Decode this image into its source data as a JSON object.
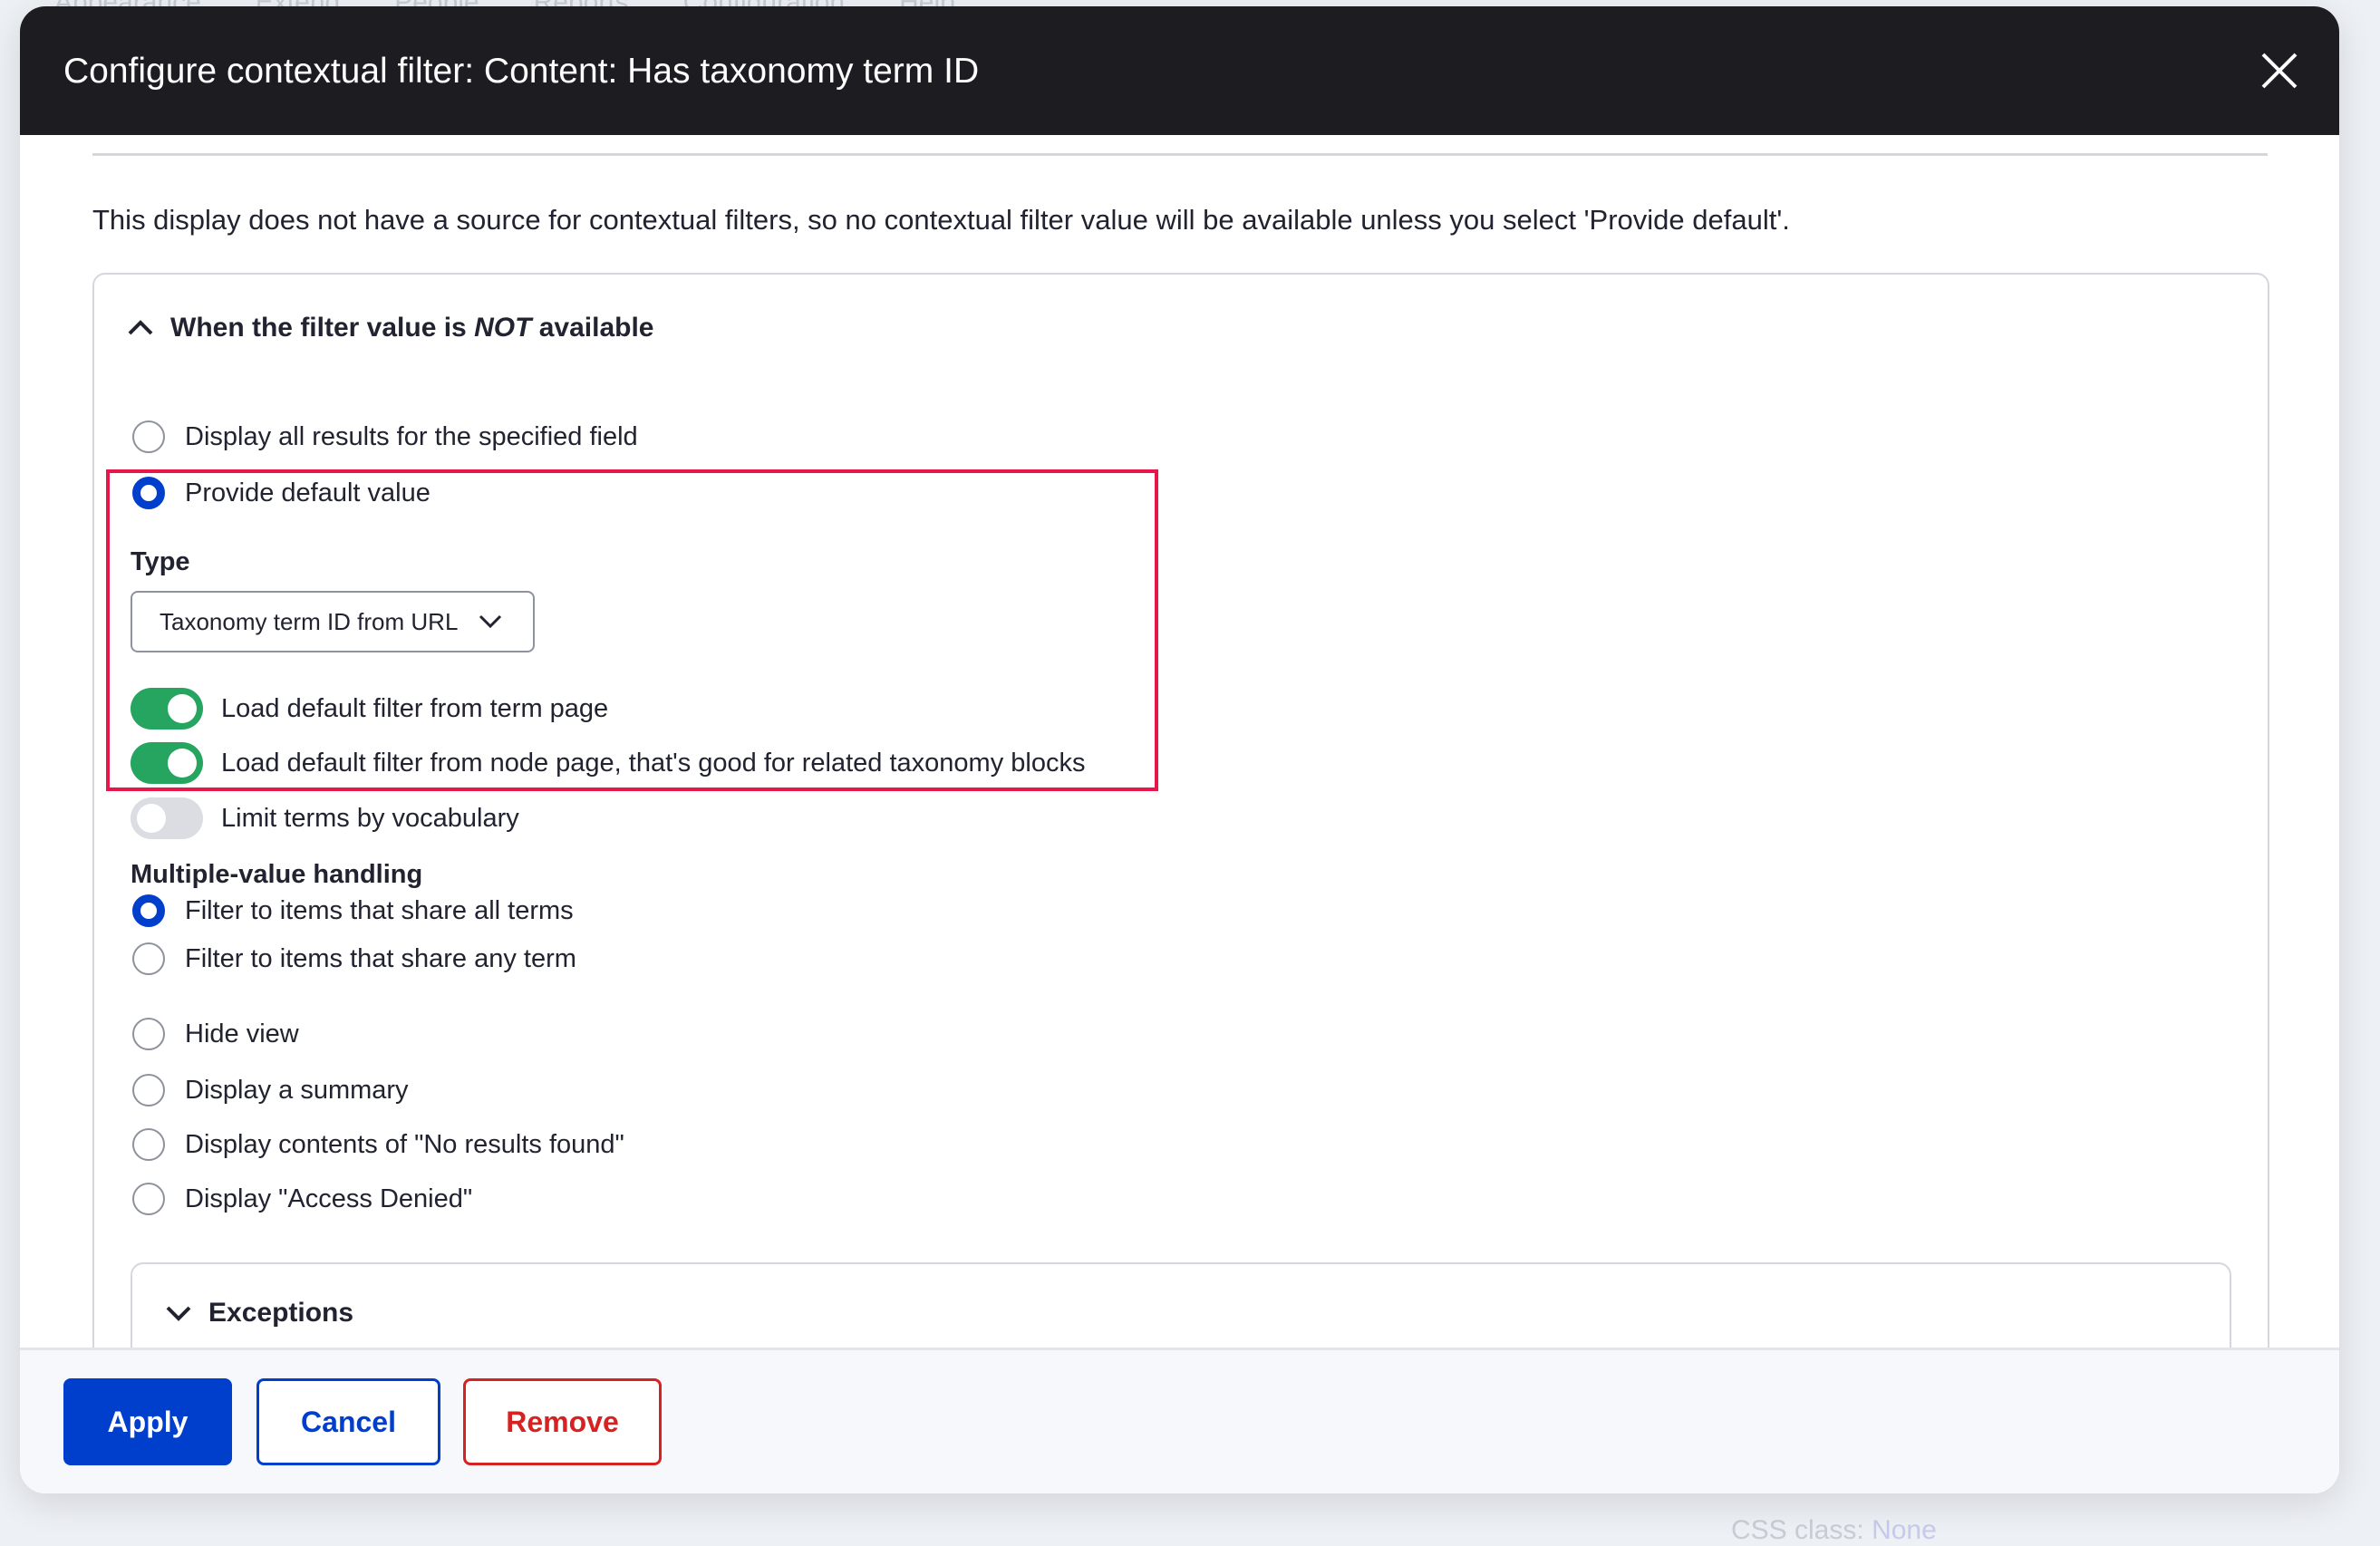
{
  "background": {
    "nav_items": [
      "Appearance",
      "Extend",
      "People",
      "Reports",
      "Configuration",
      "Help"
    ],
    "css_class_label": "CSS class:",
    "css_class_value": "None"
  },
  "dialog": {
    "title": "Configure contextual filter: Content: Has taxonomy term ID",
    "intro": "This display does not have a source for contextual filters, so no contextual filter value will be available unless you select 'Provide default'.",
    "section": {
      "legend_prefix": "When the filter value is ",
      "legend_em": "NOT",
      "legend_suffix": " available",
      "options": {
        "display_all": "Display all results for the specified field",
        "provide_default": "Provide default value"
      },
      "type_label": "Type",
      "type_value": "Taxonomy term ID from URL",
      "toggles": [
        {
          "label": "Load default filter from term page",
          "on": true
        },
        {
          "label": "Load default filter from node page, that's good for related taxonomy blocks",
          "on": true
        },
        {
          "label": "Limit terms by vocabulary",
          "on": false
        }
      ],
      "multiple_label": "Multiple-value handling",
      "multiple_options": [
        "Filter to items that share all terms",
        "Filter to items that share any term"
      ],
      "other_options": [
        "Hide view",
        "Display a summary",
        "Display contents of \"No results found\"",
        "Display \"Access Denied\""
      ],
      "selected": "Provide default value",
      "multiple_selected": "Filter to items that share all terms"
    },
    "exceptions_label": "Exceptions",
    "buttons": {
      "apply": "Apply",
      "cancel": "Cancel",
      "remove": "Remove"
    }
  },
  "colors": {
    "primary": "#003ecc",
    "toggle_on": "#25a55f",
    "danger": "#d72222",
    "highlight": "#e8174a",
    "header": "#1d1c20"
  }
}
